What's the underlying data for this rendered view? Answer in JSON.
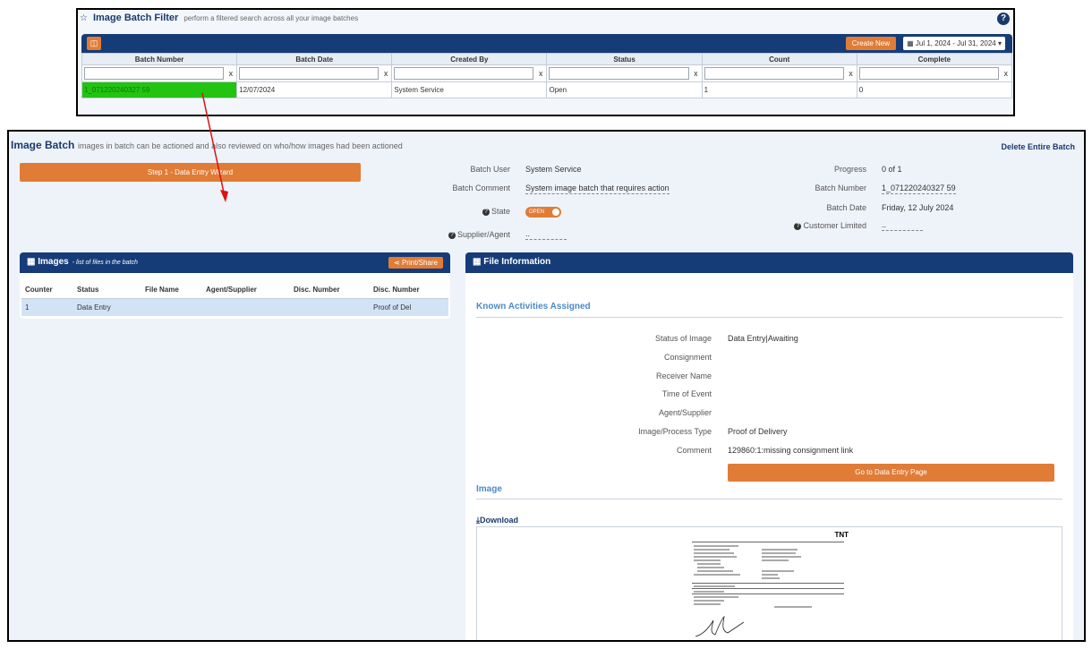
{
  "filter": {
    "star": "☆",
    "title": "Image Batch Filter",
    "subtitle": "perform a filtered search across all your image batches",
    "help": "?",
    "create_new": "Create New",
    "date_range": "Jul 1, 2024 - Jul 31, 2024",
    "columns": [
      "Batch Number",
      "Batch Date",
      "Created By",
      "Status",
      "Count",
      "Complete"
    ],
    "clear_glyph": "x",
    "row": {
      "batch_number": "1_071220240327 59",
      "batch_date": "12/07/2024",
      "created_by": "System Service",
      "status": "Open",
      "count": "1",
      "complete": "0"
    }
  },
  "batch": {
    "title": "Image Batch",
    "subtitle": "images in batch can be actioned and also reviewed on who/how images had been actioned",
    "delete": "Delete Entire Batch",
    "wizard_button": "Step 1 - Data Entry Wizard",
    "labels": {
      "user": "Batch User",
      "comment": "Batch Comment",
      "state": "State",
      "supplier": "Supplier/Agent",
      "progress": "Progress",
      "number": "Batch Number",
      "date": "Batch Date",
      "customer": "Customer Limited"
    },
    "values": {
      "user": "System Service",
      "comment": "System image batch that requires action",
      "state": "OPEN",
      "supplier": "..",
      "progress": "0 of 1",
      "number": "1_071220240327 59",
      "date": "Friday, 12 July 2024",
      "customer": ".."
    }
  },
  "images": {
    "title": "Images",
    "subtitle": "- list of files in the batch",
    "print_share": "Print/Share",
    "columns": [
      "Counter",
      "Status",
      "File Name",
      "Agent/Supplier",
      "Disc. Number",
      "Disc. Number"
    ],
    "rows": [
      {
        "counter": "1",
        "status": "Data Entry",
        "file_name": "",
        "agent": "",
        "disc1": "",
        "disc2": "Proof of Del"
      }
    ]
  },
  "file_info": {
    "title": "File Information",
    "activities_title": "Known Activities Assigned",
    "fields": [
      {
        "label": "Status of Image",
        "value": "Data Entry|Awaiting"
      },
      {
        "label": "Consignment",
        "value": ""
      },
      {
        "label": "Receiver Name",
        "value": ""
      },
      {
        "label": "Time of Event",
        "value": ""
      },
      {
        "label": "Agent/Supplier",
        "value": ""
      },
      {
        "label": "Image/Process Type",
        "value": "Proof of Delivery"
      },
      {
        "label": "Comment",
        "value": "129860:1:missing consignment link"
      }
    ],
    "data_entry_button": "Go to Data Entry Page",
    "image_title": "Image",
    "download": "Download",
    "document_logo": "TNT"
  },
  "colors": {
    "navy": "#163c78",
    "orange": "#e07c36",
    "highlight_green": "#22c311",
    "arrow_red": "#e01010"
  }
}
